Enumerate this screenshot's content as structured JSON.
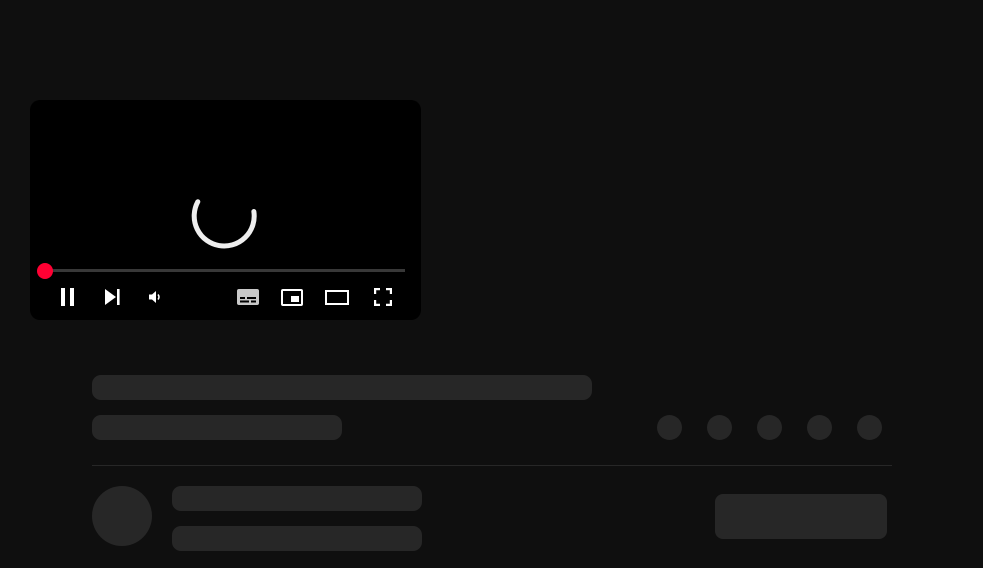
{
  "player": {
    "state": "loading",
    "progress_fraction": 0.0,
    "controls": {
      "play_pause_icon": "pause-icon",
      "next_icon": "skip-next-icon",
      "volume_icon": "volume-icon",
      "subtitles_icon": "subtitles-icon",
      "miniplayer_icon": "miniplayer-icon",
      "theater_icon": "theater-mode-icon",
      "fullscreen_icon": "fullscreen-icon"
    },
    "colors": {
      "accent": "#ff0033",
      "background": "#000000",
      "icon": "#ffffff"
    }
  },
  "page": {
    "background": "#0f0f0f",
    "skeleton_color": "#272727"
  }
}
